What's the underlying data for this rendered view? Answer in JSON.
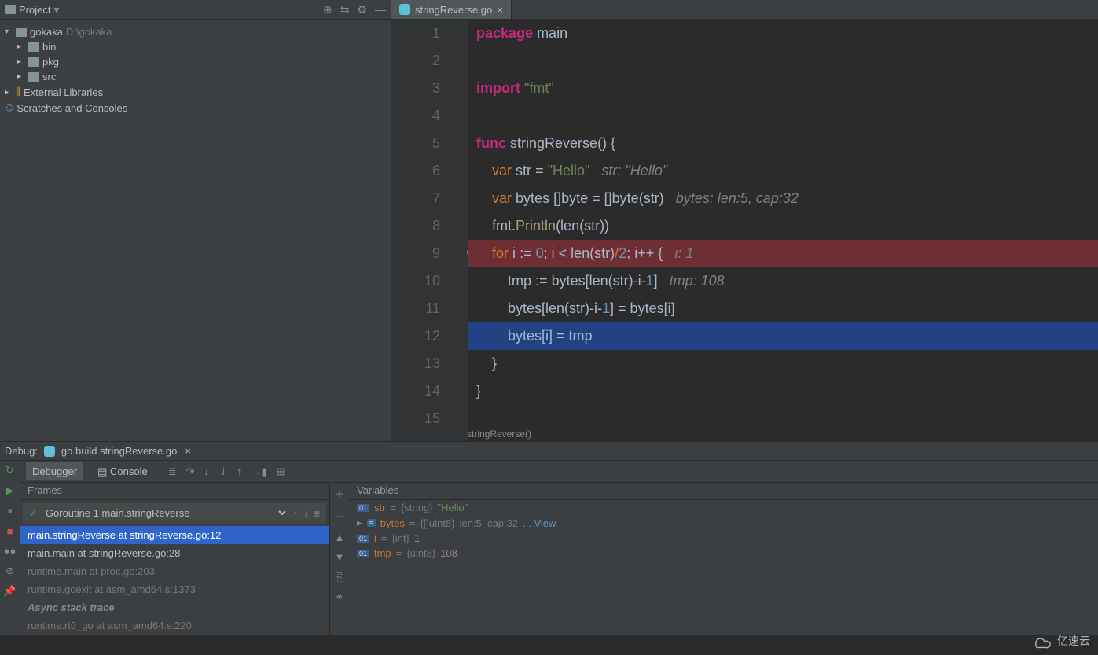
{
  "sidebar": {
    "title": "Project",
    "root": {
      "name": "gokaka",
      "path": "D:\\gokaka"
    },
    "children": [
      "bin",
      "pkg",
      "src"
    ],
    "extLibs": "External Libraries",
    "scratches": "Scratches and Consoles"
  },
  "tab": {
    "file": "stringReverse.go"
  },
  "crumb": "stringReverse()",
  "code": {
    "l1": {
      "pkg": "package",
      "main": "main"
    },
    "l3": {
      "imp": "import",
      "str": "\"fmt\""
    },
    "l5": {
      "func": "func",
      "name": "stringReverse",
      "rest": "() {"
    },
    "l6": {
      "var": "var",
      "name": "str",
      "eq": "=",
      "val": "\"Hello\"",
      "cmt": "str: \"Hello\""
    },
    "l7": {
      "var": "var",
      "name": "bytes",
      "type": "[]byte",
      "eq": "=",
      "conv": "[]byte(str)",
      "cmt": "bytes: len:5, cap:32"
    },
    "l8": {
      "fmt": "fmt",
      "dot": ".",
      "fn": "Println",
      "args": "(len(str))"
    },
    "l9": {
      "for": "for",
      "i": "i",
      ":=": ":=",
      "zero": "0",
      "semi": ";",
      "cond": "i < len(str)",
      "div": "/",
      "two": "2",
      "semi2": ";",
      "inc": "i++",
      "brace": "{",
      "cmt": "i: 1"
    },
    "l10": {
      "tmp": "tmp",
      ":=": ":=",
      "expr": "bytes[len(str)-i-",
      "one": "1",
      "close": "]",
      "cmt": "tmp: 108"
    },
    "l11": {
      "lhs": "bytes[len(str)-i-",
      "one": "1",
      "mid": "] = bytes[i]"
    },
    "l12": {
      "txt": "bytes[i] = tmp"
    },
    "l13": {
      "brace": "}"
    },
    "l14": {
      "brace": "}"
    }
  },
  "lineNums": [
    "1",
    "2",
    "3",
    "4",
    "5",
    "6",
    "7",
    "8",
    "9",
    "10",
    "11",
    "12",
    "13",
    "14",
    "15"
  ],
  "debugBar": {
    "label": "Debug:",
    "config": "go build stringReverse.go"
  },
  "debugTabs": {
    "debugger": "Debugger",
    "console": "Console"
  },
  "frames": {
    "title": "Frames",
    "goroutine": "Goroutine 1 main.stringReverse",
    "rows": [
      "main.stringReverse at stringReverse.go:12",
      "main.main at stringReverse.go:28",
      "runtime.main at proc.go:203",
      "runtime.goexit at asm_amd64.s:1373"
    ],
    "async": "Async stack trace",
    "asyncRow": "runtime.rt0_go at asm_amd64.s:220"
  },
  "vars": {
    "title": "Variables",
    "items": [
      {
        "badge": "01",
        "name": "str",
        "type": "{string}",
        "val": "\"Hello\"",
        "kind": "str"
      },
      {
        "badge": "≡",
        "name": "bytes",
        "type": "{[]uint8}",
        "val": "len:5, cap:32",
        "link": "... View",
        "kind": "arr"
      },
      {
        "badge": "01",
        "name": "i",
        "type": "{int}",
        "val": "1",
        "kind": "num"
      },
      {
        "badge": "01",
        "name": "tmp",
        "type": "{uint8}",
        "val": "108",
        "kind": "num"
      }
    ]
  },
  "watermark": "亿速云"
}
